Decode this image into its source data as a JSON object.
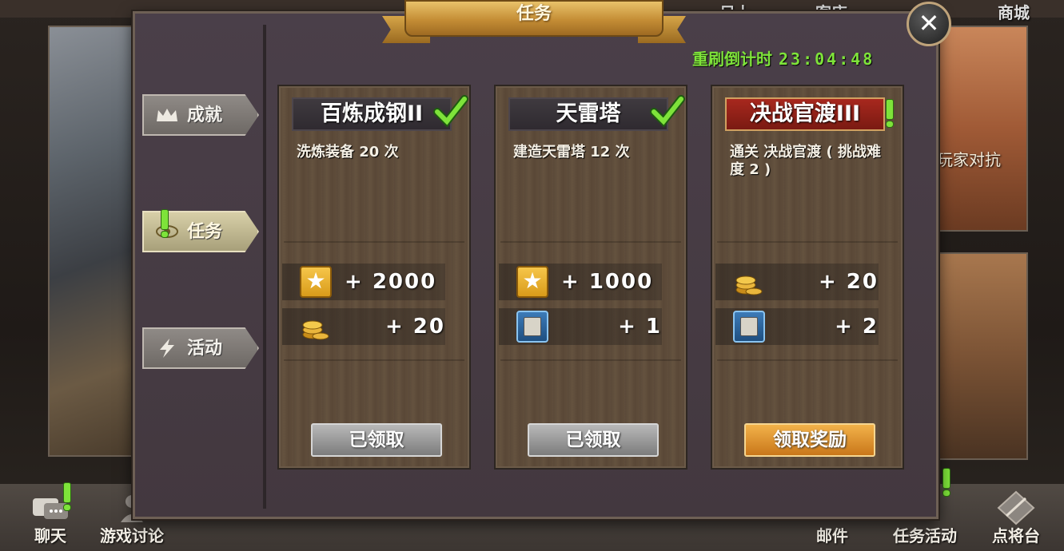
{
  "background": {
    "top_nav": [
      "日上",
      "客店",
      "商城"
    ],
    "right_art_text": "玩家对抗",
    "bottom_bar": [
      {
        "label": "聊天",
        "icon": "chat-icon",
        "alert": true
      },
      {
        "label": "游戏讨论",
        "icon": "discussion-icon",
        "alert": false
      },
      {
        "label": "邮件",
        "icon": "mail-icon",
        "alert": false
      },
      {
        "label": "任务活动",
        "icon": "quest-icon",
        "alert": true
      },
      {
        "label": "点将台",
        "icon": "general-platform-icon",
        "alert": false
      }
    ]
  },
  "dialog": {
    "title": "任务",
    "close_icon": "close-icon",
    "refresh_label": "重刷倒计时",
    "refresh_time": "23:04:48"
  },
  "tabs": [
    {
      "label": "成就",
      "icon": "crown-icon",
      "active": false,
      "alert": false
    },
    {
      "label": "任务",
      "icon": "eye-icon",
      "active": true,
      "alert": true
    },
    {
      "label": "活动",
      "icon": "lightning-icon",
      "active": false,
      "alert": false
    }
  ],
  "missions": [
    {
      "name": "百炼成钢II",
      "status_icon": "checkmark-icon",
      "desc": "洗炼装备 20 次",
      "rewards": [
        {
          "icon": "star-icon",
          "value": "+ 2000"
        },
        {
          "icon": "gold-coins-icon",
          "value": "+ 20"
        }
      ],
      "button": "已领取",
      "button_state": "claimed"
    },
    {
      "name": "天雷塔",
      "status_icon": "checkmark-icon",
      "desc": "建造天雷塔 12 次",
      "rewards": [
        {
          "icon": "star-icon",
          "value": "+ 1000"
        },
        {
          "icon": "general-card-icon",
          "value": "+ 1"
        }
      ],
      "button": "已领取",
      "button_state": "claimed"
    },
    {
      "name": "决战官渡III",
      "status_icon": "exclamation-icon",
      "desc": "通关 决战官渡 ( 挑战难度 2 )",
      "rewards": [
        {
          "icon": "gold-coins-icon",
          "value": "+ 20"
        },
        {
          "icon": "general-card-icon",
          "value": "+ 2"
        }
      ],
      "button": "领取奖励",
      "button_state": "claimable"
    }
  ],
  "colors": {
    "accent_green": "#7ee33a",
    "claim_orange": "#e0962e",
    "claimed_gray": "#9a9a9a",
    "banner_gold": "#c48d35"
  }
}
